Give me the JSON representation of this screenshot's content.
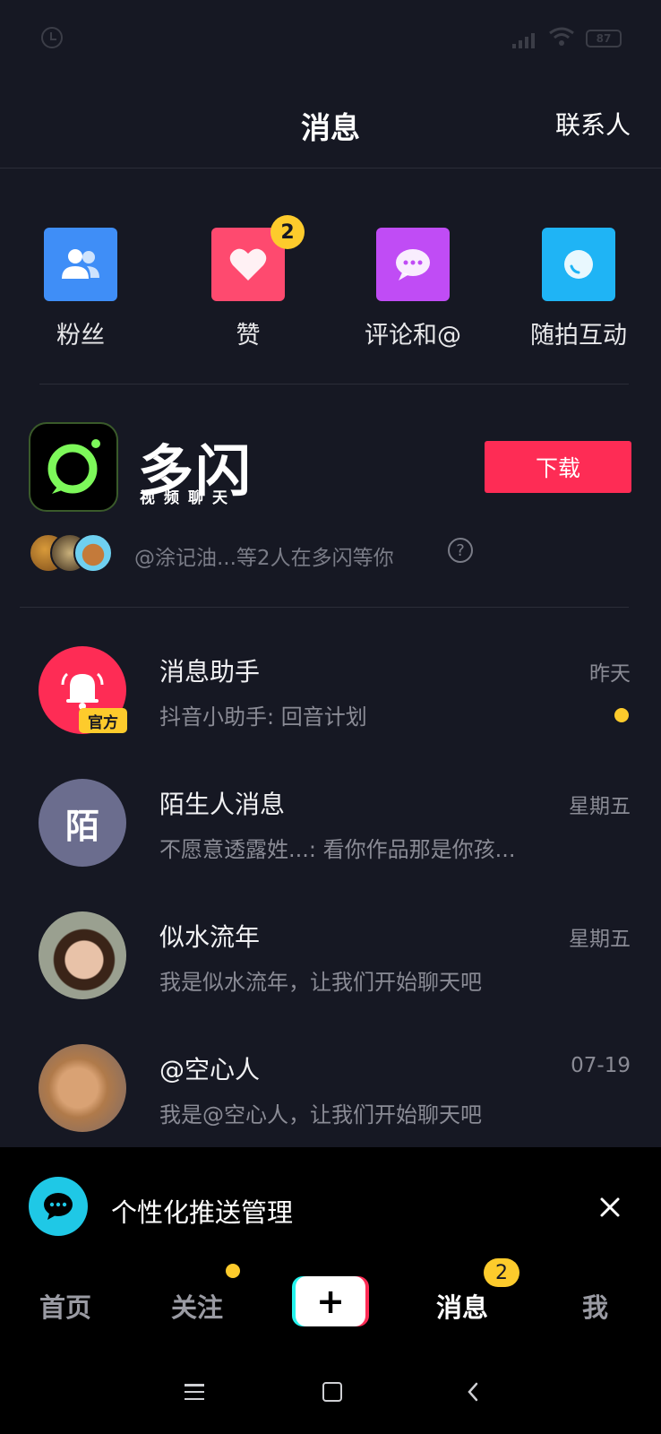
{
  "status_bar": {
    "battery": "87"
  },
  "header": {
    "title": "消息",
    "contacts_label": "联系人"
  },
  "quick_actions": [
    {
      "label": "粉丝",
      "icon": "fans-icon",
      "color": "#3f8ef7"
    },
    {
      "label": "赞",
      "icon": "heart-icon",
      "color": "#fe4a6f",
      "badge": "2"
    },
    {
      "label": "评论和@",
      "icon": "comment-icon",
      "color": "#c04cf5"
    },
    {
      "label": "随拍互动",
      "icon": "snapshot-icon",
      "color": "#1fb4f5"
    }
  ],
  "promo": {
    "app_name": "多闪",
    "app_subtitle": "视频聊天",
    "download_label": "下载",
    "waiting_text": "@涂记油...等2人在多闪等你"
  },
  "conversations": [
    {
      "name": "消息助手",
      "preview": "抖音小助手: 回音计划",
      "time": "昨天",
      "tag": "官方",
      "unread": true
    },
    {
      "name": "陌生人消息",
      "preview": "不愿意透露姓...: 看你作品那是你孩...",
      "time": "星期五",
      "avatar_text": "陌"
    },
    {
      "name": "似水流年",
      "preview": "我是似水流年，让我们开始聊天吧",
      "time": "星期五"
    },
    {
      "name": "@空心人",
      "preview": "我是@空心人，让我们开始聊天吧",
      "time": "07-19"
    }
  ],
  "push_banner": {
    "text": "个性化推送管理"
  },
  "bottom_tabs": [
    {
      "label": "首页"
    },
    {
      "label": "关注"
    },
    {
      "label": "消息",
      "badge": "2"
    },
    {
      "label": "我"
    }
  ]
}
